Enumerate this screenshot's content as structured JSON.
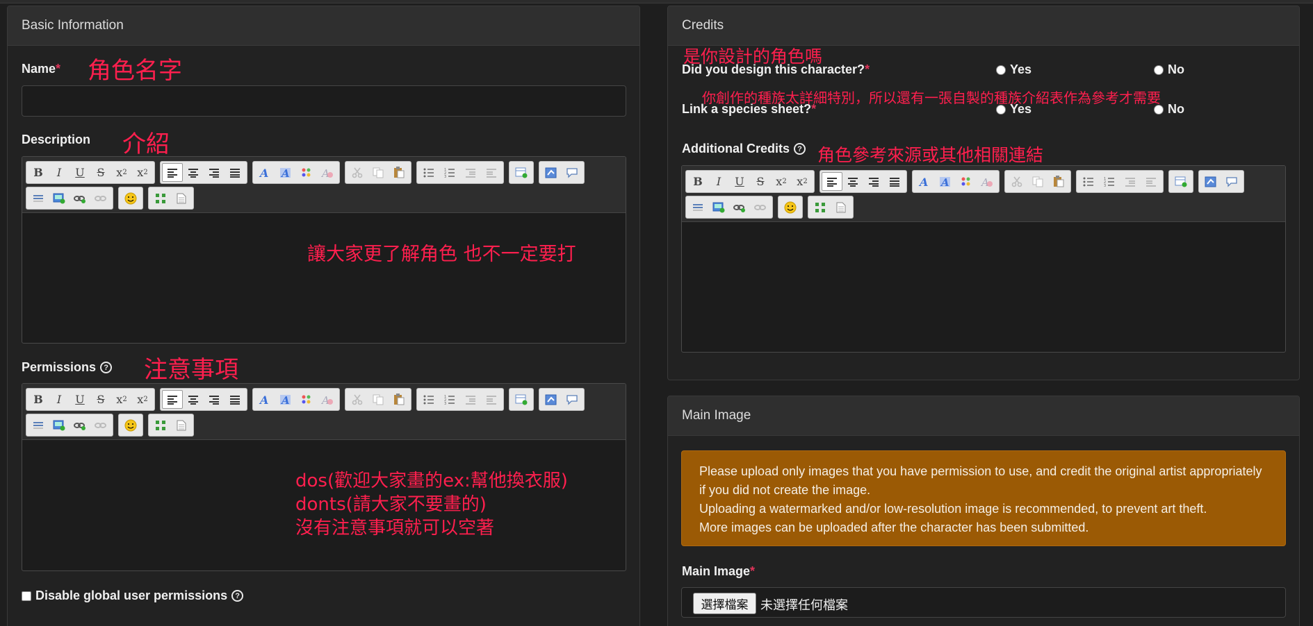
{
  "basic": {
    "header": "Basic Information",
    "name_label": "Name",
    "name_value": "",
    "description_label": "Description",
    "permissions_label": "Permissions",
    "disable_label": "Disable global user permissions",
    "annotations": {
      "name": "角色名字",
      "description": "介紹",
      "description_body": "讓大家更了解角色 也不一定要打",
      "permissions": "注意事項",
      "permissions_line1": "dos(歡迎大家畫的ex:幫他換衣服)",
      "permissions_line2": "donts(請大家不要畫的)",
      "permissions_line3": "沒有注意事項就可以空著"
    }
  },
  "credits": {
    "header": "Credits",
    "design_question": "Did you design this character?",
    "species_question": "Link a species sheet?",
    "yes_label": "Yes",
    "no_label": "No",
    "additional_label": "Additional Credits",
    "annotations": {
      "design": "是你設計的角色嗎",
      "species": "你創作的種族太詳細特別，所以還有一張自製的種族介紹表作為參考才需要",
      "additional": "角色參考來源或其他相關連結"
    }
  },
  "main_image": {
    "header": "Main Image",
    "alert_line1": "Please upload only images that you have permission to use, and credit the original artist appropriately",
    "alert_line2": "if you did not create the image.",
    "alert_line3": "Uploading a watermarked and/or low-resolution image is recommended, to prevent art theft.",
    "alert_line4": "More images can be uploaded after the character has been submitted.",
    "label": "Main Image",
    "choose_button": "選擇檔案",
    "no_file": "未選擇任何檔案"
  },
  "editor_toolbar": {
    "bold": "B",
    "italic": "I",
    "underline": "U",
    "strike": "S",
    "subscript": "x",
    "superscript": "x",
    "sub_mark": "2",
    "sup_mark": "2"
  }
}
